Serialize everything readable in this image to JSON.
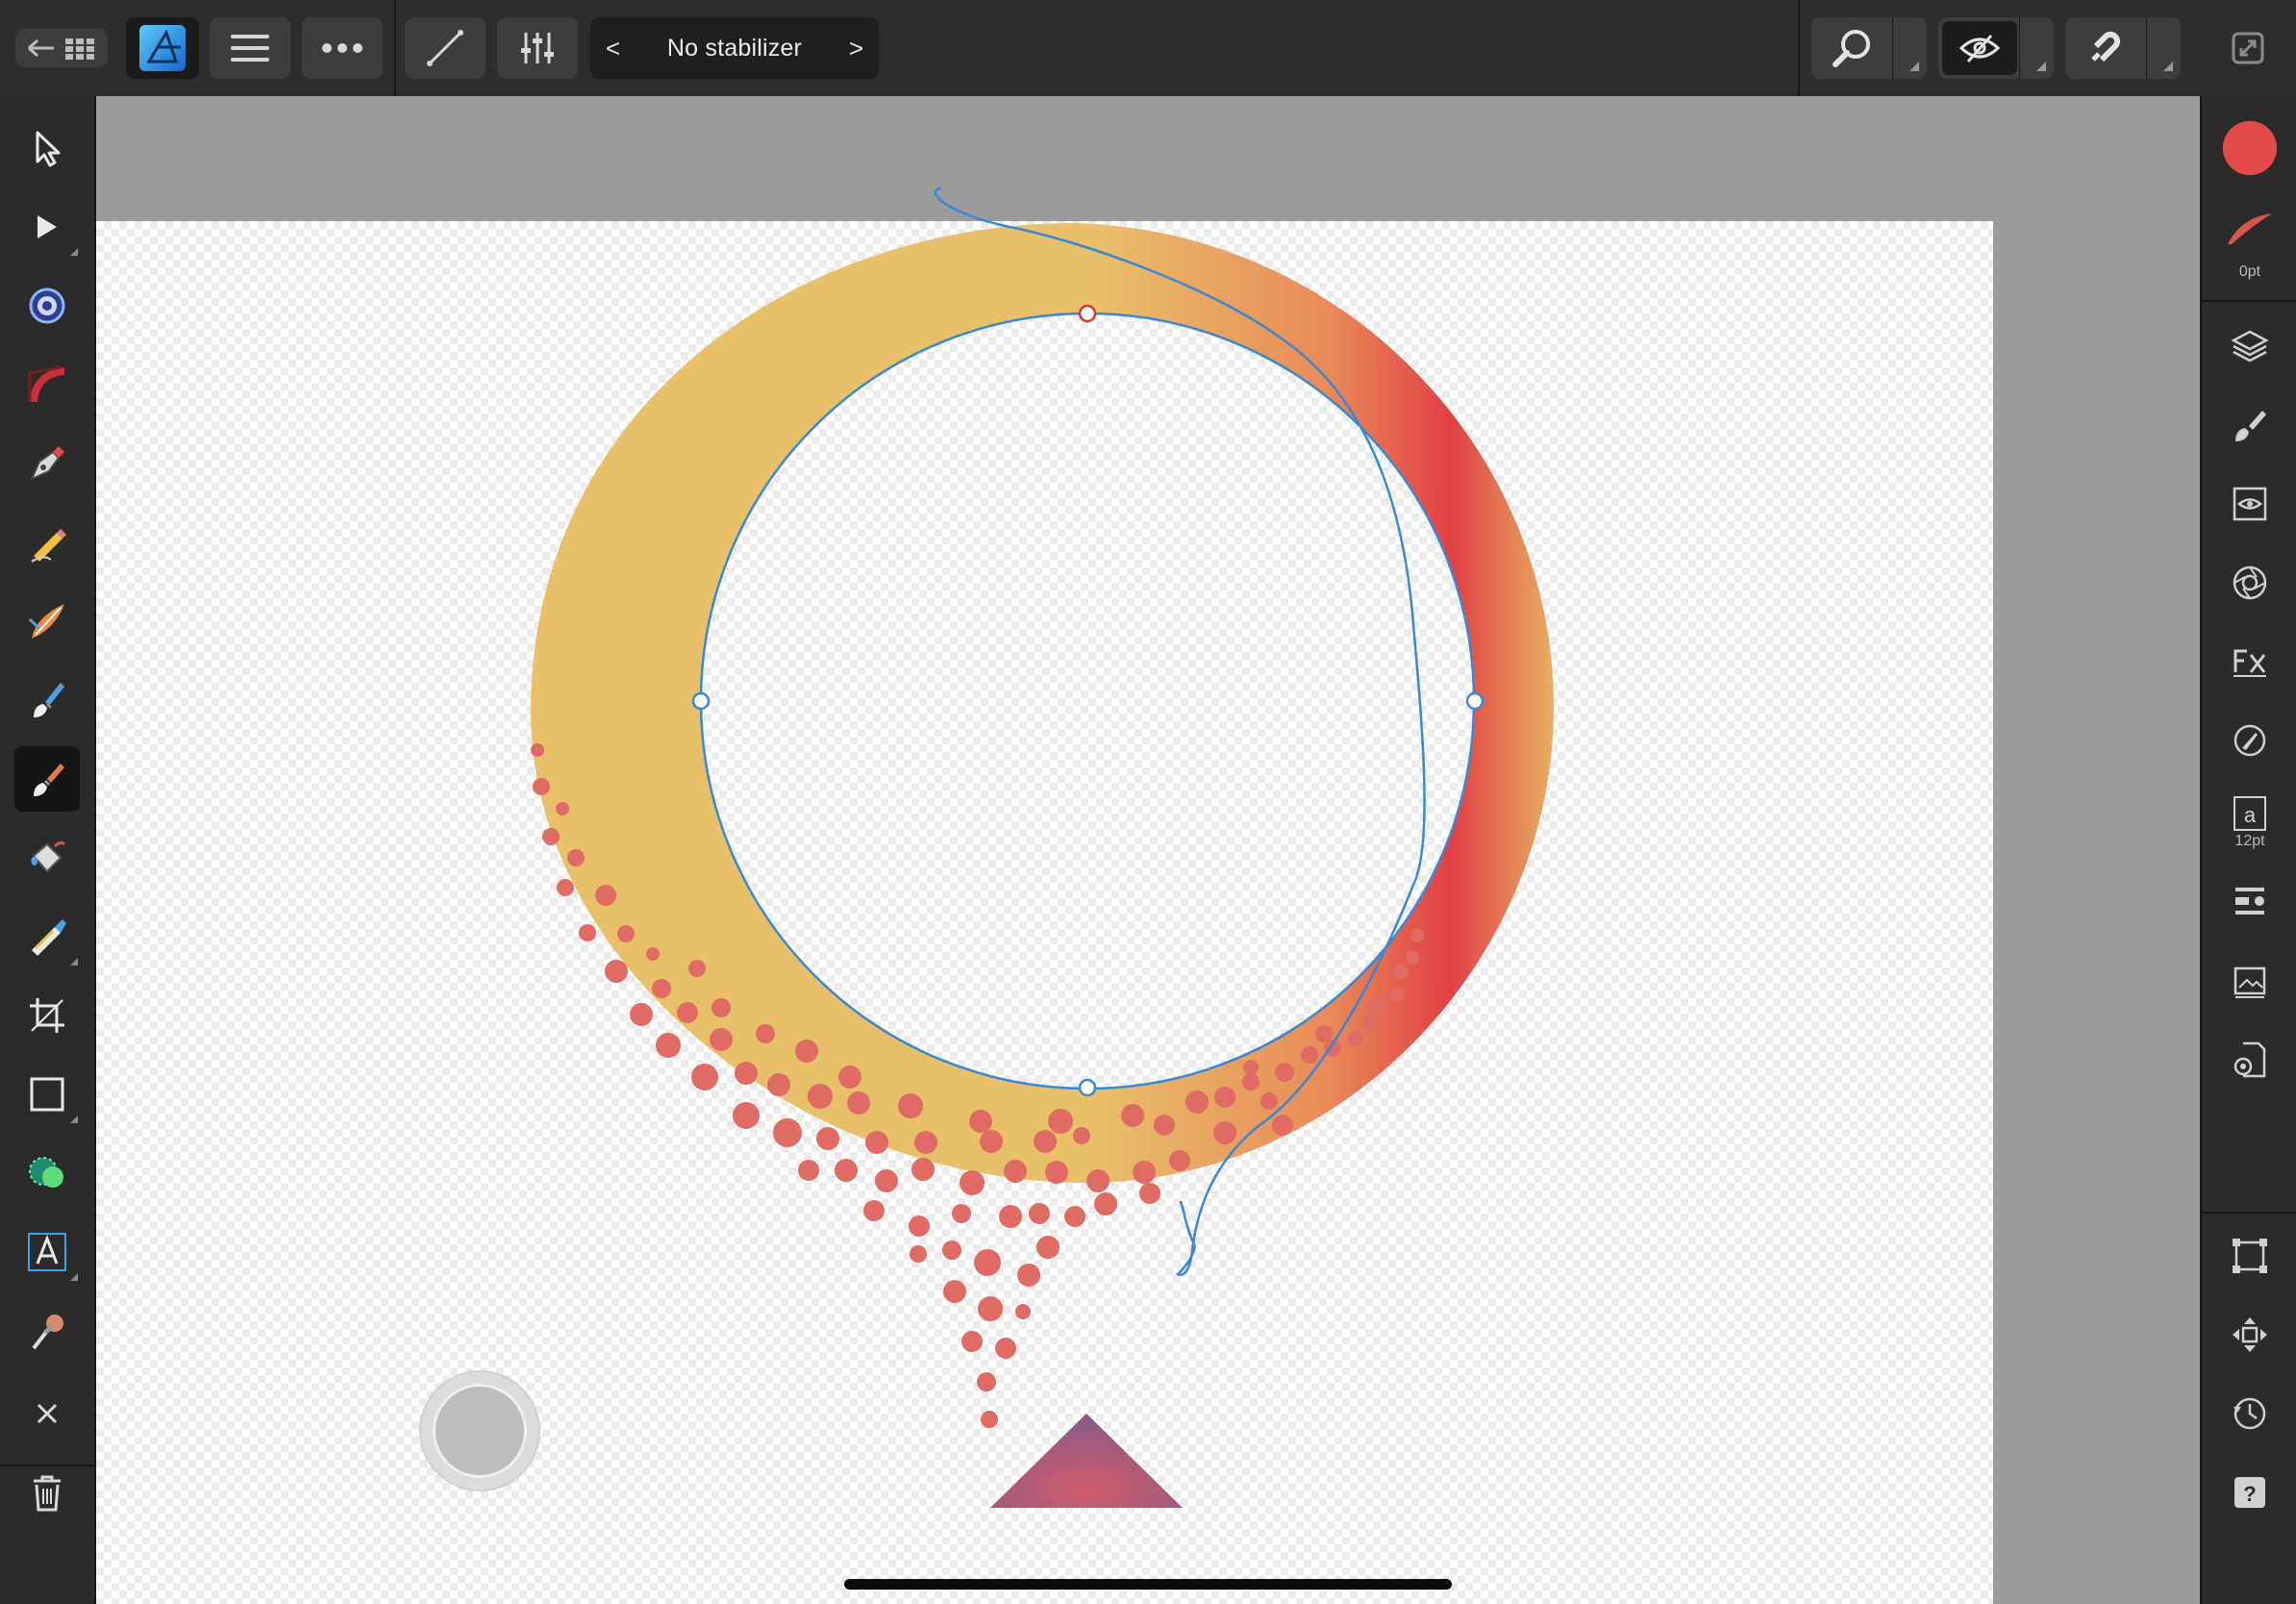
{
  "app": {
    "name": "Affinity Designer"
  },
  "toolbar": {
    "stabilizer_label": "No stabilizer",
    "prev_label": "<",
    "next_label": ">"
  },
  "left_tools": [
    "move-tool",
    "node-tool",
    "corner-tool",
    "gradient-tool",
    "pen-tool",
    "pencil-tool",
    "vector-brush-tool",
    "paint-brush-tool",
    "pixel-brush-tool",
    "fill-tool",
    "transparency-tool",
    "crop-tool",
    "rectangle-tool",
    "shape-builder-tool",
    "artistic-text-tool",
    "color-picker-tool"
  ],
  "active_tool": "pixel-brush-tool",
  "right_studio": {
    "stroke_width_label": "0pt",
    "text_size_label": "12pt",
    "fill_color": "#e44a4a",
    "stroke_color": "#d9564f"
  },
  "colors": {
    "ring_fill": "#e8c06a",
    "ring_accent": "#e24244",
    "dots": "#e06a64",
    "selection": "#3a87d4",
    "handle_active": "#e53030"
  }
}
